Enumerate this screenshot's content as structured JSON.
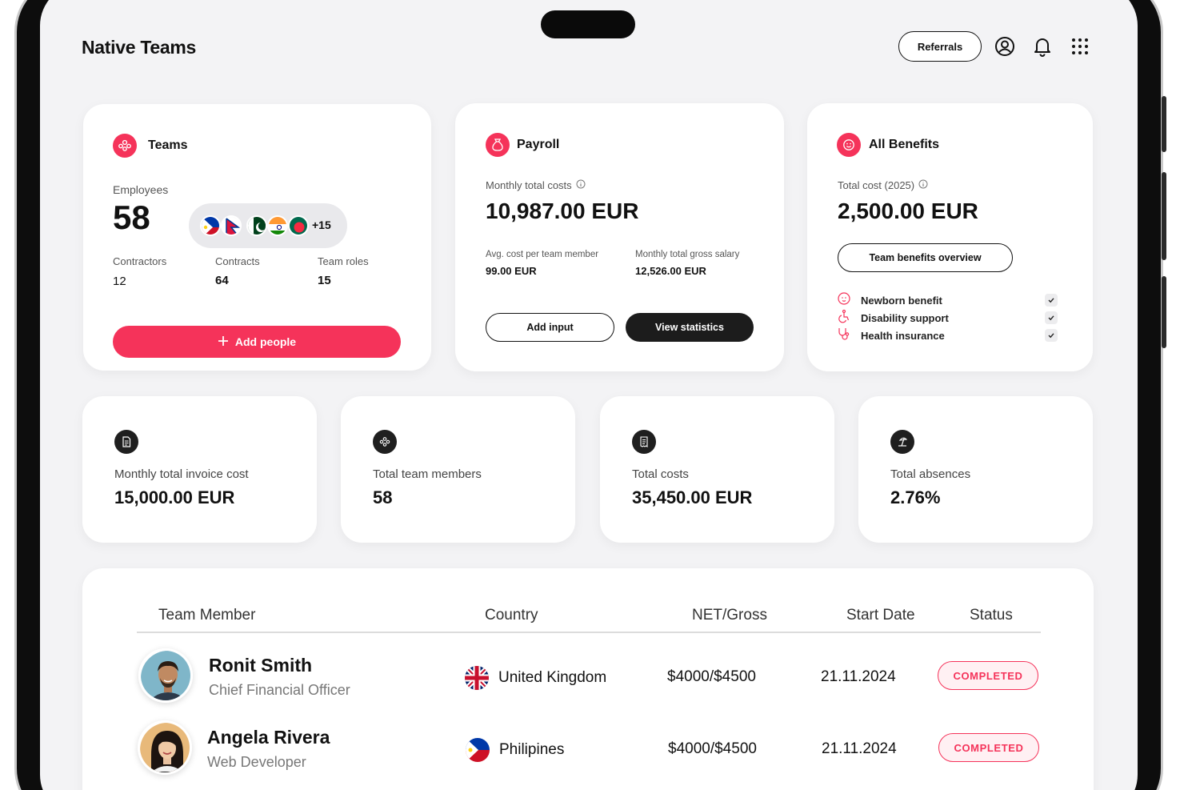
{
  "header": {
    "logo": "Native Teams",
    "referrals_label": "Referrals",
    "icons": [
      "user-icon",
      "bell-icon",
      "apps-grid-icon"
    ]
  },
  "teams_card": {
    "title": "Teams",
    "employees_label": "Employees",
    "employees_value": "58",
    "flags": [
      "philippines",
      "nepal",
      "pakistan",
      "india",
      "bangladesh"
    ],
    "flags_more": "+15",
    "contractors_label": "Contractors",
    "contractors_value": "12",
    "contracts_label": "Contracts",
    "contracts_value": "64",
    "team_roles_label": "Team roles",
    "team_roles_value": "15",
    "add_people_label": "Add people"
  },
  "payroll_card": {
    "title": "Payroll",
    "monthly_total_label": "Monthly total costs",
    "monthly_total_value": "10,987.00 EUR",
    "avg_cost_label": "Avg. cost per team member",
    "avg_cost_value": "99.00 EUR",
    "gross_salary_label": "Monthly total gross salary",
    "gross_salary_value": "12,526.00 EUR",
    "add_input_label": "Add input",
    "view_statistics_label": "View statistics"
  },
  "benefits_card": {
    "title": "All Benefits",
    "total_cost_label": "Total cost (2025)",
    "total_cost_value": "2,500.00 EUR",
    "overview_label": "Team benefits overview",
    "items": [
      {
        "label": "Newborn benefit",
        "icon": "baby-icon"
      },
      {
        "label": "Disability support",
        "icon": "wheelchair-icon"
      },
      {
        "label": "Health insurance",
        "icon": "stethoscope-icon"
      }
    ]
  },
  "stats": [
    {
      "label": "Monthly total invoice cost",
      "value": "15,000.00 EUR",
      "icon": "document-icon"
    },
    {
      "label": "Total team members",
      "value": "58",
      "icon": "team-icon"
    },
    {
      "label": "Total costs",
      "value": "35,450.00 EUR",
      "icon": "receipt-icon"
    },
    {
      "label": "Total absences",
      "value": "2.76%",
      "icon": "beach-icon"
    }
  ],
  "table": {
    "headers": [
      "Team Member",
      "Country",
      "NET/Gross",
      "Start Date",
      "Status"
    ],
    "rows": [
      {
        "name": "Ronit Smith",
        "role": "Chief Financial Officer",
        "country": "United Kingdom",
        "net_gross": "$4000/$4500",
        "start_date": "21.11.2024",
        "status": "COMPLETED"
      },
      {
        "name": "Angela Rivera",
        "role": "Web Developer",
        "country": "Philipines",
        "net_gross": "$4000/$4500",
        "start_date": "21.11.2024",
        "status": "COMPLETED"
      }
    ]
  },
  "colors": {
    "accent": "#f5335a",
    "dark": "#1c1c1c",
    "background": "#f3f3f5"
  }
}
